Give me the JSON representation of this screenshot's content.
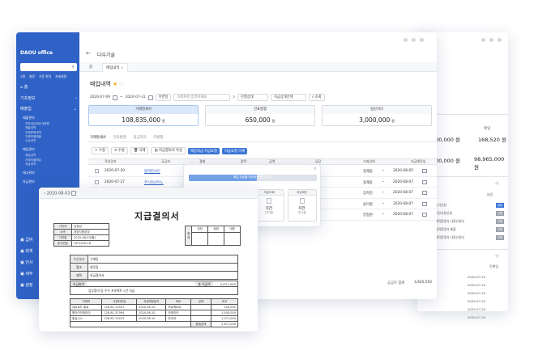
{
  "sidebar": {
    "logo": "DAOU office",
    "user_items": [
      "1명",
      "설정",
      "기준 위치",
      "자세설정"
    ],
    "home": "홈",
    "menu": [
      {
        "label": "기초정보",
        "arrow": "›"
      },
      {
        "label": "매출입",
        "arrow": "⌄"
      }
    ],
    "sections": [
      {
        "title": "매출관리",
        "items": [
          "전자세금계산서발행",
          "매출내역",
          "자재판매내역",
          "거래처별매출",
          "수금내역"
        ]
      },
      {
        "title": "매입관리",
        "items": [
          "매입내역",
          "거래처별매입",
          "지급내역"
        ]
      },
      {
        "title": "재고관리",
        "items": []
      },
      {
        "title": "자금관리",
        "items": []
      }
    ],
    "bottom_items": [
      {
        "label": "급여"
      },
      {
        "label": "회계"
      },
      {
        "label": "인사"
      },
      {
        "label": "세무"
      },
      {
        "label": "설정"
      }
    ]
  },
  "topbar": {
    "title": "다우기술",
    "tabs": [
      "홈",
      "매입내역"
    ]
  },
  "page": {
    "title": "매입내역"
  },
  "filters": {
    "date_from": "2020-07-09",
    "date_to": "2020-07-31",
    "period": "이번달",
    "vendor_placeholder": "거래처명 입력하세요",
    "status": "진행상태",
    "status2": "지급상태전체",
    "search": "조회"
  },
  "summary": [
    {
      "label": "거래명세서",
      "value": "108,835,000",
      "unit": "원",
      "active": true
    },
    {
      "label": "전표발행",
      "value": "650,000",
      "unit": "원",
      "active": false
    },
    {
      "label": "정산처리",
      "value": "3,000,000",
      "unit": "원",
      "active": false
    }
  ],
  "content_tabs": [
    "거래명세서",
    "전표발행",
    "입금처리",
    "미발행"
  ],
  "toolbar": {
    "new_label": "+ 수정",
    "edit_label": "수정",
    "delete_label": "삭제",
    "print_label": "지급결의서 작성",
    "pay_request": "매입대금 지급요청",
    "pay_approve": "지급요청 이체"
  },
  "table": {
    "headers": [
      "",
      "작성일자",
      "공급처",
      "결재",
      "품목",
      "금액",
      "",
      "담당",
      "",
      "거래상태",
      "",
      "지급예정일"
    ],
    "rows": [
      {
        "date": "2020-07-20",
        "vendor": "블랙천사인",
        "owner": "정재웅",
        "due": "2020-08-05"
      },
      {
        "date": "2020-07-27",
        "vendor": "주식회사이노",
        "owner": "정재웅",
        "due": "2020-08-07"
      },
      {
        "date": "2020-07-27",
        "vendor": "",
        "owner": "장희진",
        "due": "2020-08-07"
      },
      {
        "date": "2020-07-28",
        "vendor": "",
        "owner": "송미정",
        "due": "2020-08-07"
      },
      {
        "date": "2020-07-28",
        "vendor": "",
        "owner": "양정원",
        "due": "2020-08-07"
      }
    ],
    "footer_label": "공급가 합계",
    "footer_value": "3,645,550"
  },
  "popup": {
    "progress_text": "매입 자료를 처리하는 중 (8/15)",
    "cards": [
      {
        "title": "계산서",
        "count": "4건",
        "sub": "완료"
      },
      {
        "title": "계좌",
        "count": "0건",
        "sub": "대기중"
      },
      {
        "title": "지급조회",
        "count": "0건",
        "sub": "대기중"
      },
      {
        "title": "지급확인",
        "count": "0건",
        "sub": "대기중"
      }
    ]
  },
  "right_window": {
    "header": "매입",
    "rows": [
      {
        "a": "100,000 원",
        "b": "168,520 원"
      },
      {
        "a": "000,000 원",
        "b": "98,965,000 원"
      }
    ],
    "list_header": "분류",
    "list": [
      "등기신청",
      "완전사원신청",
      "재직증명서 사용신청서",
      "경력증명서 제출",
      "재직증명서 사용신청서"
    ],
    "badges": [
      "완료",
      "진행",
      "진행",
      "진행",
      "진행"
    ],
    "dates": [
      "2020-07-20",
      "2020-07-20",
      "2020-07-20",
      "2020-07-20",
      "2020-07-20",
      "2020-07-20"
    ]
  },
  "doc": {
    "date": "2020-08-03",
    "title": "지급결의서",
    "info": [
      [
        "기안자",
        "김정남"
      ],
      [
        "소속",
        "경영지원본부"
      ],
      [
        "기안일",
        "2020-08-03(월)"
      ],
      [
        "문서번호",
        "GP-2020-16"
      ]
    ],
    "approvals": [
      "담당",
      "팀장",
      "대표"
    ],
    "approvals2": [
      "결재",
      "합의"
    ],
    "fields": [
      [
        "수신부서",
        "구매팀"
      ],
      [
        "협조",
        "재무팀"
      ],
      [
        "제목",
        "지급결의서"
      ]
    ],
    "amount_label": "지급총액",
    "amount_value": "2,671,000",
    "purpose": "업무협약 등 우수 프로젝트 2건 지급",
    "items_header": [
      "거래처",
      "사업자번호",
      "지급예정일자",
      "적요",
      "금액",
      "비고"
    ],
    "items": [
      [
        "네트로드 회로",
        "128-81-12521",
        "2020-08-10",
        "프로젝트비",
        "",
        "150,000"
      ],
      [
        "원라인인테리어",
        "128-81-37094",
        "2020-08-10",
        "인테리어",
        "",
        "1,450,000"
      ],
      [
        "홍실시스",
        "128-82-70223",
        "2020-08-10",
        "외주비",
        "",
        "1,071,000"
      ]
    ],
    "total_label": "합계금액",
    "total_value": "2,671,000"
  }
}
